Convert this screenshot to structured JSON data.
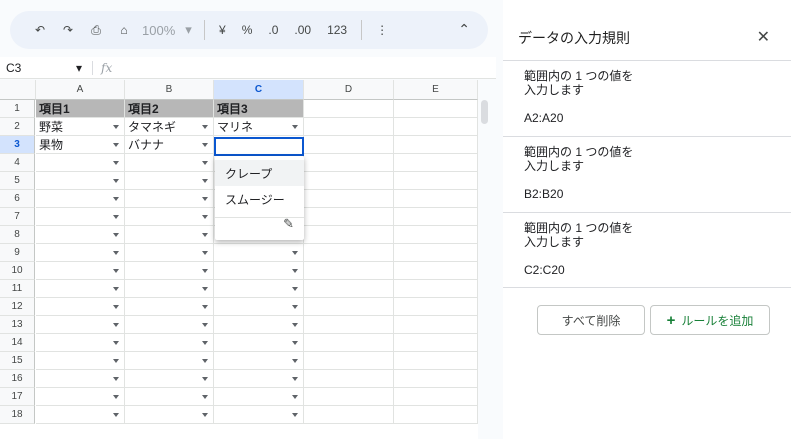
{
  "toolbar": {
    "undo_icon": "↶",
    "redo_icon": "↷",
    "print_icon": "⎙",
    "paint_icon": "⌂",
    "zoom": "100%",
    "currency": "¥",
    "percent": "%",
    "dec_decrease": ".0",
    "dec_increase": ".00",
    "format_123": "123",
    "more_icon": "⋮",
    "collapse_icon": "⌃"
  },
  "formula_bar": {
    "cell_ref": "C3",
    "fx": "fx"
  },
  "columns": [
    "A",
    "B",
    "C",
    "D",
    "E"
  ],
  "rows": [
    "1",
    "2",
    "3",
    "4",
    "5",
    "6",
    "7",
    "8",
    "9",
    "10",
    "11",
    "12",
    "13",
    "14",
    "15",
    "16",
    "17",
    "18"
  ],
  "cells": {
    "r1": [
      "項目1",
      "項目2",
      "項目3"
    ],
    "r2": [
      "野菜",
      "タマネギ",
      "マリネ"
    ],
    "r3": [
      "果物",
      "バナナ",
      ""
    ]
  },
  "dropdown": {
    "options": [
      "クレープ",
      "スムージー"
    ],
    "edit_icon": "✎"
  },
  "panel": {
    "title": "データの入力規則",
    "close_icon": "✕",
    "rules": [
      {
        "line1": "範囲内の 1 つの値を",
        "line2": "入力します",
        "range": "A2:A20"
      },
      {
        "line1": "範囲内の 1 つの値を",
        "line2": "入力します",
        "range": "B2:B20"
      },
      {
        "line1": "範囲内の 1 つの値を",
        "line2": "入力します",
        "range": "C2:C20"
      }
    ],
    "delete_all": "すべて削除",
    "add_rule": "ルールを追加"
  }
}
